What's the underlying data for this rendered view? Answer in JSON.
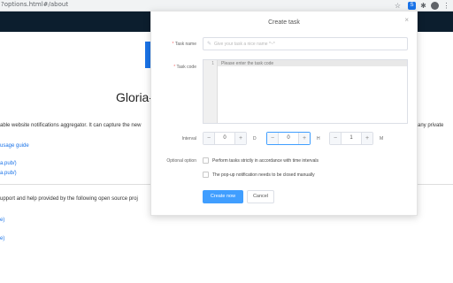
{
  "browser": {
    "url": "?options.html#/about",
    "ext_badge": "S",
    "avatar_initial": "●"
  },
  "background_page": {
    "title": "Gloria-",
    "desc_left": "able website notifications aggregator. It can capture the new",
    "desc_right": "any private",
    "usage_link": "usage guide",
    "link1": "a.pub/)",
    "link2": "a.pub/)",
    "support_text": "upport and help provided by the following open source proj",
    "link3": "e)",
    "link4": "e)"
  },
  "modal": {
    "title": "Create task",
    "close_glyph": "×",
    "task_name": {
      "required_mark": "*",
      "label": "Task name",
      "placeholder": "Give your task a nice name *~*",
      "value": ""
    },
    "task_code": {
      "required_mark": "*",
      "label": "Task code",
      "line_number": "1",
      "placeholder": "Please enter the task code"
    },
    "interval": {
      "label": "Interval",
      "days": {
        "value": "0",
        "unit": "D"
      },
      "hours": {
        "value": "0",
        "unit": "H"
      },
      "minutes": {
        "value": "1",
        "unit": "M"
      },
      "minus_glyph": "−",
      "plus_glyph": "+"
    },
    "optional": {
      "label": "Optional option",
      "option1": "Perform tasks strictly in accordance with time intervals",
      "option2": "The pop-up notification needs to be closed manually"
    },
    "buttons": {
      "create": "Create now",
      "cancel": "Cancel"
    }
  }
}
